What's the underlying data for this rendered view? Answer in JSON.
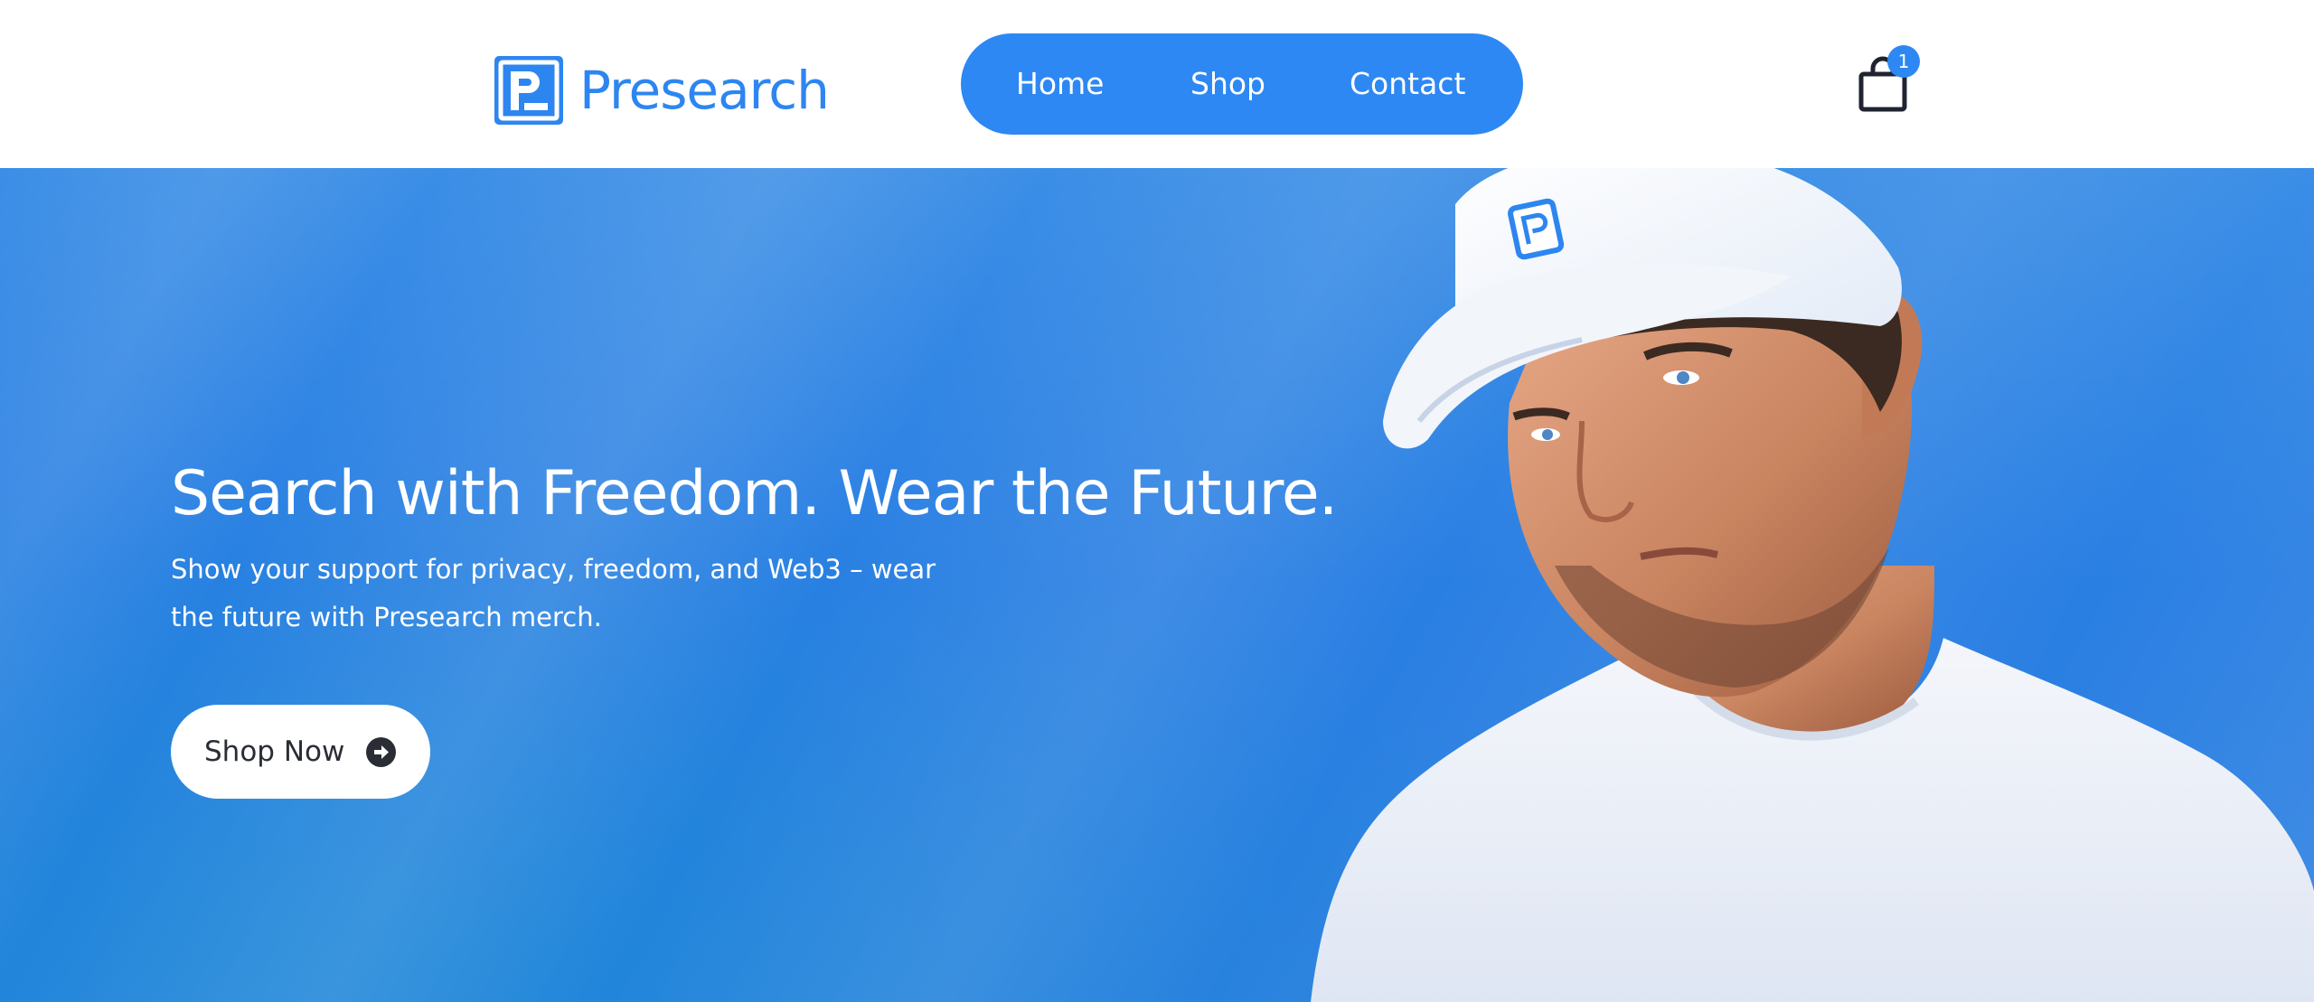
{
  "header": {
    "logo_text": "Presearch",
    "nav": {
      "home": "Home",
      "shop": "Shop",
      "contact": "Contact"
    },
    "cart": {
      "count": "1",
      "icon": "shopping-bag-icon"
    }
  },
  "hero": {
    "title": "Search with Freedom. Wear the Future.",
    "subtitle": "Show your support for privacy, freedom, and Web3 – wear the future with Presearch merch.",
    "cta_label": "Shop Now",
    "cta_icon": "arrow-right-circle-icon",
    "image_description": "Man wearing white Presearch cap and white t-shirt"
  },
  "colors": {
    "brand_blue": "#2d88f3",
    "hero_blue": "#2a7fe3",
    "white": "#ffffff",
    "dark_text": "#2a2e34"
  }
}
